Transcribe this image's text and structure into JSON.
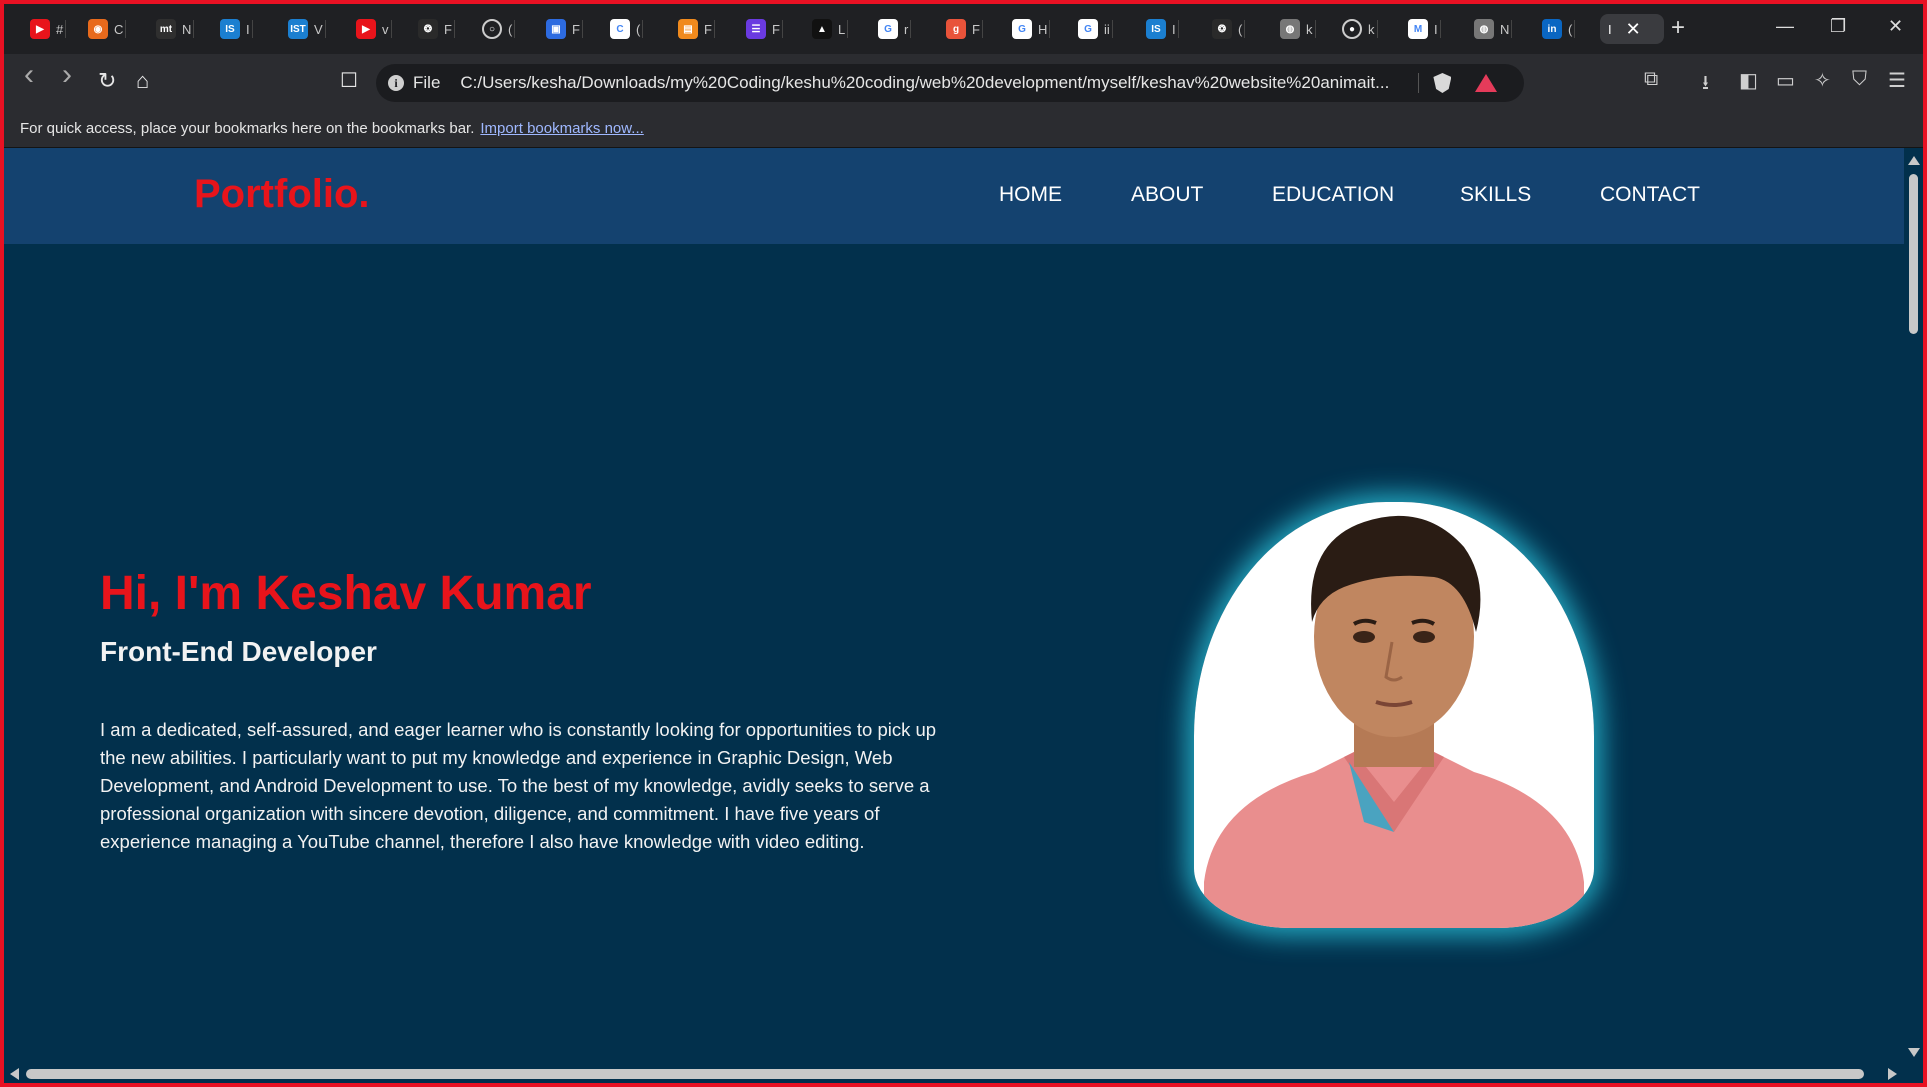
{
  "browser": {
    "tabs": [
      {
        "icon": "youtube-icon",
        "color": "#e8141b",
        "glyph": "▶",
        "label": "#"
      },
      {
        "icon": "brave-shield-icon",
        "color": "#e86a1c",
        "glyph": "◉",
        "label": "C"
      },
      {
        "icon": "mt-icon",
        "color": "#2f2f2f",
        "glyph": "mt",
        "label": "N"
      },
      {
        "icon": "is-icon",
        "color": "#1b7fd0",
        "glyph": "IS",
        "label": "I"
      },
      {
        "icon": "ist-icon",
        "color": "#1b7fd0",
        "glyph": "IST",
        "label": "V"
      },
      {
        "icon": "youtube-icon",
        "color": "#e8141b",
        "glyph": "▶",
        "label": "v"
      },
      {
        "icon": "openai-icon",
        "color": "#2a2a2a",
        "glyph": "❂",
        "label": "F"
      },
      {
        "icon": "circle-icon",
        "color": "#1f2023",
        "glyph": "○",
        "label": "("
      },
      {
        "icon": "app-icon",
        "color": "#2d6be0",
        "glyph": "▣",
        "label": "F"
      },
      {
        "icon": "c-icon",
        "color": "#ffffff",
        "glyph": "C",
        "label": "("
      },
      {
        "icon": "orange-app-icon",
        "color": "#f08a1d",
        "glyph": "▤",
        "label": "F"
      },
      {
        "icon": "list-app-icon",
        "color": "#6a3ae0",
        "glyph": "☰",
        "label": "F"
      },
      {
        "icon": "triangle-app-icon",
        "color": "#111111",
        "glyph": "▲",
        "label": "L"
      },
      {
        "icon": "google-icon",
        "color": "#ffffff",
        "glyph": "G",
        "label": "r"
      },
      {
        "icon": "g-app-icon",
        "color": "#e8533a",
        "glyph": "g",
        "label": "F"
      },
      {
        "icon": "google-icon",
        "color": "#ffffff",
        "glyph": "G",
        "label": "H"
      },
      {
        "icon": "google-icon",
        "color": "#ffffff",
        "glyph": "G",
        "label": "ii"
      },
      {
        "icon": "is-icon",
        "color": "#1b7fd0",
        "glyph": "IS",
        "label": "I"
      },
      {
        "icon": "openai-icon",
        "color": "#2a2a2a",
        "glyph": "❂",
        "label": "("
      },
      {
        "icon": "globe-icon",
        "color": "#777777",
        "glyph": "◍",
        "label": "k"
      },
      {
        "icon": "github-icon",
        "color": "#1f2023",
        "glyph": "●",
        "label": "k"
      },
      {
        "icon": "gmail-icon",
        "color": "#ffffff",
        "glyph": "M",
        "label": "I"
      },
      {
        "icon": "globe-icon",
        "color": "#777777",
        "glyph": "◍",
        "label": "N"
      },
      {
        "icon": "linkedin-icon",
        "color": "#0a66c2",
        "glyph": "in",
        "label": "("
      }
    ],
    "active_tab": {
      "label": "I",
      "close": "✕"
    },
    "new_tab": "+",
    "window_controls": {
      "minimize": "—",
      "restore": "❐",
      "close": "✕"
    },
    "toolbar": {
      "back": "‹",
      "forward": "›",
      "reload": "↻",
      "home": "⌂",
      "bookmark": "☐",
      "scheme": "File",
      "url": "C:/Users/kesha/Downloads/my%20Coding/keshu%20coding/web%20development/myself/keshav%20website%20animait...",
      "right_icons": [
        "⧉",
        "⭳",
        "◧",
        "▭",
        "✧",
        "⛉",
        "☰"
      ]
    },
    "bookmarks_bar": {
      "hint": "For quick access, place your bookmarks here on the bookmarks bar.",
      "import_link": "Import bookmarks now..."
    }
  },
  "site": {
    "logo": "Portfolio.",
    "nav": [
      "HOME",
      "ABOUT",
      "EDUCATION",
      "SKILLS",
      "CONTACT"
    ],
    "hero": {
      "title": "Hi, I'm Keshav Kumar",
      "subtitle": "Front-End Developer",
      "body": "I am a dedicated, self-assured, and eager learner who is constantly looking for opportunities to pick up the new abilities. I particularly want to put my knowledge and experience in Graphic Design, Web Development, and Android Development to use. To the best of my knowledge, avidly seeks to serve a professional organization with sincere devotion, diligence, and commitment. I have five years of experience managing a YouTube channel, therefore I also have knowledge with video editing."
    }
  },
  "colors": {
    "frame_border": "#e81123",
    "header_bg": "#14426f",
    "page_bg": "#02304c",
    "accent_red": "#e8141b",
    "glow": "#2dcde6"
  }
}
